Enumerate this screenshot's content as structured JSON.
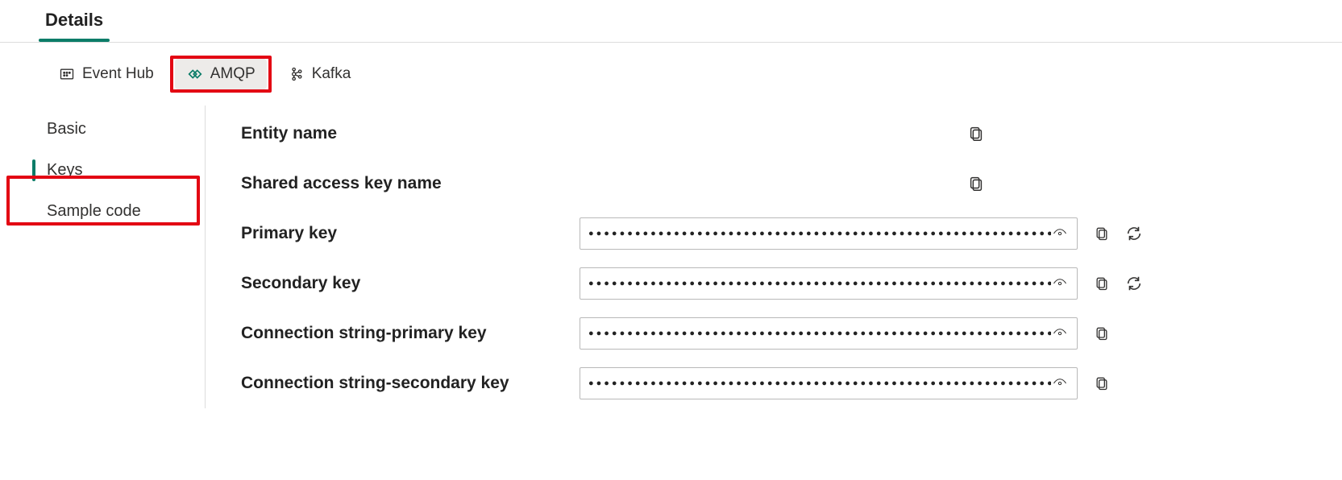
{
  "top_tabs": {
    "details": "Details"
  },
  "proto_tabs": {
    "event_hub": "Event Hub",
    "amqp": "AMQP",
    "kafka": "Kafka",
    "selected": "amqp"
  },
  "sidebar": {
    "basic": "Basic",
    "keys": "Keys",
    "sample_code": "Sample code",
    "active": "keys"
  },
  "labels": {
    "entity_name": "Entity name",
    "shared_access_key_name": "Shared access key name",
    "primary_key": "Primary key",
    "secondary_key": "Secondary key",
    "conn_primary": "Connection string-primary key",
    "conn_secondary": "Connection string-secondary key"
  },
  "mask": "●●●●●●●●●●●●●●●●●●●●●●●●●●●●●●●●●●●●●●●●●●●●●●●●●●●●●●●●●●●●●●●●●●●●●●●●●●●●●●●●"
}
